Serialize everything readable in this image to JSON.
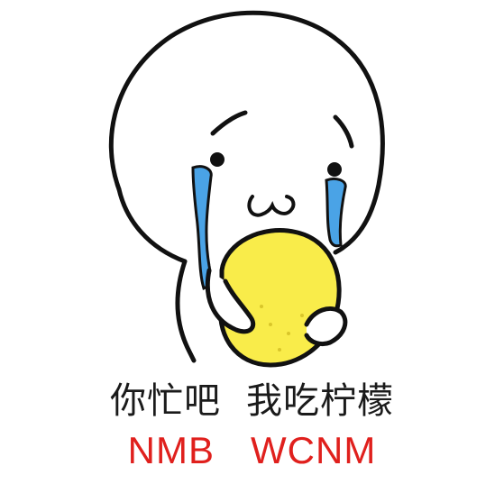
{
  "caption": {
    "line1_left": "你忙吧",
    "line1_right": "我吃柠檬",
    "line2_left": "NMB",
    "line2_right": "WCNM"
  },
  "colors": {
    "caption_cn": "#1a1a1a",
    "caption_en": "#e0201d",
    "lemon": "#f9ec4a",
    "lemon_outline": "#1a1a1a",
    "tears": "#4aa3e6",
    "background": "#ffffff"
  },
  "icons": {
    "character": "crying-round-head-character",
    "lemon": "lemon-icon"
  }
}
